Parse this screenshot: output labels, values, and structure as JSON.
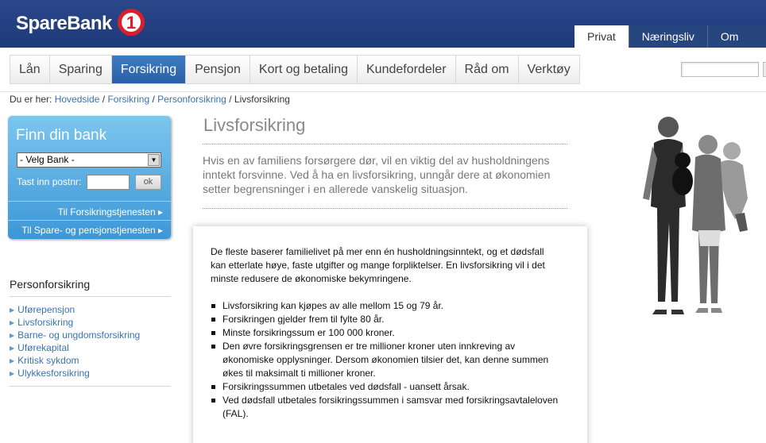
{
  "brand": {
    "name": "SpareBank",
    "mark": "1"
  },
  "top_tabs": [
    {
      "label": "Privat"
    },
    {
      "label": "Næringsliv"
    },
    {
      "label": "Om oss/l"
    }
  ],
  "nav": [
    {
      "label": "Lån"
    },
    {
      "label": "Sparing"
    },
    {
      "label": "Forsikring"
    },
    {
      "label": "Pensjon"
    },
    {
      "label": "Kort og betaling"
    },
    {
      "label": "Kundefordeler"
    },
    {
      "label": "Råd om"
    },
    {
      "label": "Verktøy"
    }
  ],
  "breadcrumb": {
    "prefix": "Du er her:",
    "items": [
      "Hovedside",
      "Forsikring",
      "Personforsikring"
    ],
    "sep": "/",
    "current": "Livsforsikring"
  },
  "bankbox": {
    "title": "Finn din bank",
    "select_value": "- Velg Bank -",
    "postnr_label": "Tast inn postnr:",
    "ok_label": "ok",
    "link1": "Til Forsikringstjenesten",
    "link2": "Til Spare- og pensjonstjenesten"
  },
  "side": {
    "title": "Personforsikring",
    "items": [
      "Uførepensjon",
      "Livsforsikring",
      "Barne- og ungdomsforsikring",
      "Uførekapital",
      "Kritisk sykdom",
      "Ulykkesforsikring"
    ]
  },
  "main": {
    "title": "Livsforsikring",
    "intro": "Hvis en av familiens forsørgere dør, vil en viktig del av husholdningens inntekt forsvinne. Ved å ha en livsforsikring, unngår dere at økonomien setter begrensninger i en allerede vanskelig situasjon.",
    "card_text": "De fleste baserer familielivet på mer enn én husholdningsinntekt, og et dødsfall kan etterlate høye, faste utgifter og mange forpliktelser. En livsforsikring vil i det minste redusere de økonomiske bekymringene.",
    "bullets": [
      "Livsforsikring kan kjøpes av alle mellom 15 og 79 år.",
      "Forsikringen gjelder frem til fylte 80 år.",
      "Minste forsikringssum er 100 000 kroner.",
      "Den øvre forsikringsgrensen er tre millioner kroner uten innkreving av økonomiske opplysninger. Dersom økonomien tilsier det, kan denne summen økes til maksimalt ti millioner kroner.",
      "Forsikringssummen utbetales ved dødsfall - uansett årsak.",
      "Ved dødsfall utbetales forsikringssummen i samsvar med forsikringsavtaleloven (FAL)."
    ]
  },
  "colors": {
    "header": "#1f3a7a",
    "nav_active": "#2b5fa7",
    "link": "#3a72b0",
    "bankbox": "#3d97d6",
    "logo_red": "#d8202a"
  },
  "icons": {
    "logo": "sparebank-1-logo",
    "select_arrow": "chevron-down-icon",
    "link_arrow": "triangle-right-icon",
    "list_arrow": "triangle-right-icon"
  }
}
